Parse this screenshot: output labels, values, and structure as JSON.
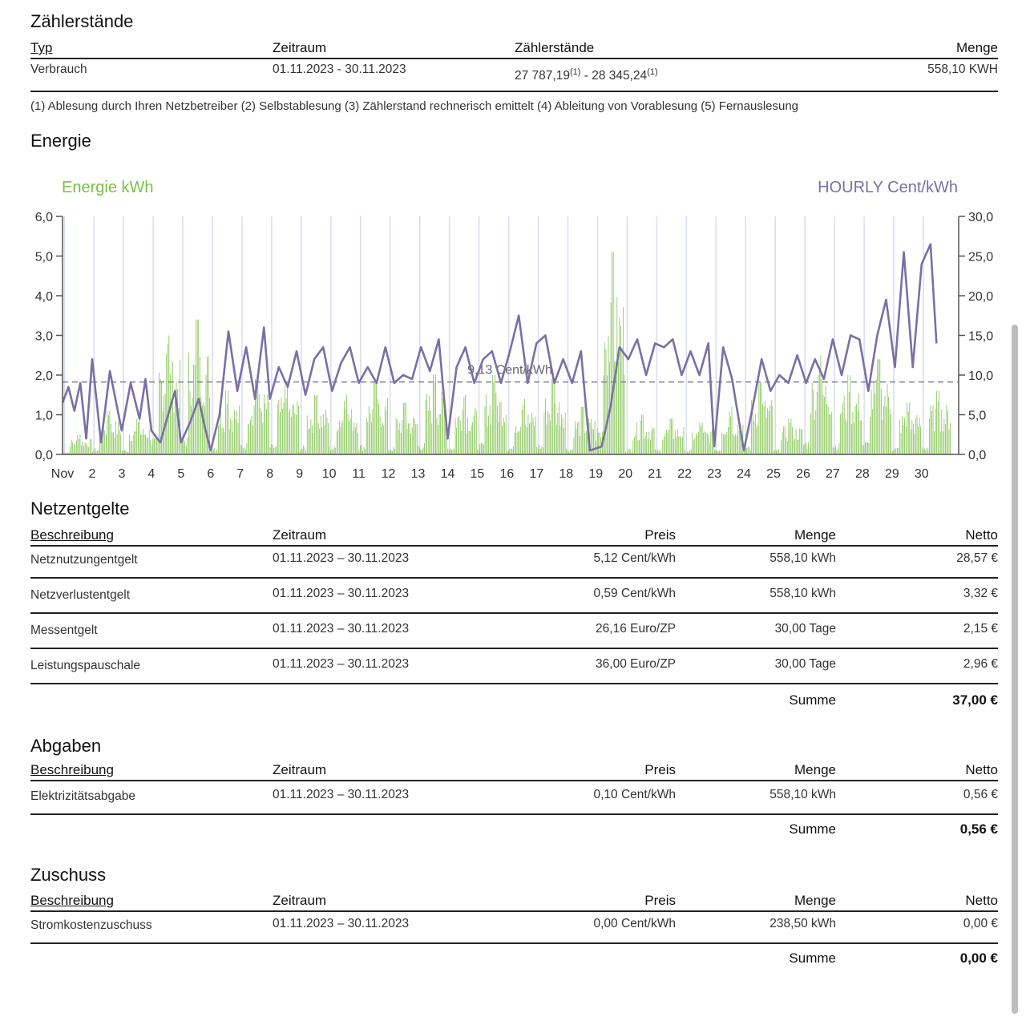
{
  "zaehlerstaende": {
    "title": "Zählerstände",
    "headers": [
      "Typ",
      "Zeitraum",
      "Zählerstände",
      "Menge"
    ],
    "row": {
      "typ": "Verbrauch",
      "zeitraum": "01.11.2023 - 30.11.2023",
      "stand_start": "27 787,19",
      "stand_start_note": "(1)",
      "separator": " - ",
      "stand_end": "28 345,24",
      "stand_end_note": "(1)",
      "menge": "558,10 KWH"
    },
    "footnote": "(1) Ablesung durch Ihren Netzbetreiber (2) Selbstablesung (3) Zählerstand rechnerisch emittelt (4) Ableitung von Vorablesung (5) Fernauslesung"
  },
  "energie": {
    "title": "Energie",
    "colors": {
      "energy": "#7ac143",
      "price": "#7b6fa6",
      "grid": "#d8dcf0",
      "axis": "#555555",
      "avg": "#7f7f99"
    }
  },
  "chart_data": {
    "type": "bar",
    "legend_left": "Energie kWh",
    "legend_right": "HOURLY Cent/kWh",
    "avg_label": "9,13 Cent/kWh",
    "avg_value": 9.13,
    "ylim_left": [
      0,
      6
    ],
    "ylim_right": [
      0,
      30
    ],
    "y_ticks_left": [
      "0,0",
      "1,0",
      "2,0",
      "3,0",
      "4,0",
      "5,0",
      "6,0"
    ],
    "y_ticks_right": [
      "0,0",
      "5,0",
      "10,0",
      "15,0",
      "20,0",
      "25,0",
      "30,0"
    ],
    "x_ticks": [
      "Nov",
      "2",
      "3",
      "4",
      "5",
      "6",
      "7",
      "8",
      "9",
      "10",
      "11",
      "12",
      "13",
      "14",
      "15",
      "16",
      "17",
      "18",
      "19",
      "20",
      "21",
      "22",
      "23",
      "24",
      "25",
      "26",
      "27",
      "28",
      "29",
      "30"
    ],
    "days": 30,
    "grid": true,
    "series": [
      {
        "name": "Energie kWh",
        "axis": "left",
        "daily_peak_kwh": [
          0.5,
          1.1,
          0.9,
          3.0,
          3.4,
          1.6,
          2.0,
          1.8,
          1.5,
          1.5,
          1.8,
          1.3,
          2.0,
          1.5,
          2.0,
          1.4,
          1.9,
          1.2,
          5.1,
          1.0,
          0.9,
          0.8,
          1.2,
          1.8,
          0.9,
          2.5,
          2.0,
          2.4,
          1.3,
          1.6
        ]
      },
      {
        "name": "HOURLY Cent/kWh",
        "axis": "right",
        "points": [
          [
            1.0,
            6.5
          ],
          [
            1.2,
            8.5
          ],
          [
            1.4,
            5.5
          ],
          [
            1.6,
            9.0
          ],
          [
            1.8,
            2.0
          ],
          [
            2.0,
            12.0
          ],
          [
            2.3,
            1.5
          ],
          [
            2.6,
            10.5
          ],
          [
            3.0,
            3.0
          ],
          [
            3.3,
            9.0
          ],
          [
            3.6,
            4.5
          ],
          [
            3.8,
            9.5
          ],
          [
            4.0,
            3.0
          ],
          [
            4.3,
            1.5
          ],
          [
            4.6,
            5.5
          ],
          [
            4.8,
            8.0
          ],
          [
            5.0,
            1.5
          ],
          [
            5.3,
            4.0
          ],
          [
            5.6,
            7.0
          ],
          [
            5.8,
            3.5
          ],
          [
            6.0,
            0.5
          ],
          [
            6.3,
            5.0
          ],
          [
            6.6,
            15.5
          ],
          [
            6.9,
            8.0
          ],
          [
            7.2,
            13.5
          ],
          [
            7.5,
            7.0
          ],
          [
            7.8,
            16.0
          ],
          [
            8.0,
            7.0
          ],
          [
            8.3,
            11.0
          ],
          [
            8.6,
            8.5
          ],
          [
            8.9,
            13.0
          ],
          [
            9.2,
            7.5
          ],
          [
            9.5,
            12.0
          ],
          [
            9.8,
            13.5
          ],
          [
            10.1,
            8.0
          ],
          [
            10.4,
            11.5
          ],
          [
            10.7,
            13.5
          ],
          [
            11.0,
            9.0
          ],
          [
            11.3,
            11.0
          ],
          [
            11.6,
            9.0
          ],
          [
            11.9,
            13.5
          ],
          [
            12.2,
            9.0
          ],
          [
            12.5,
            10.0
          ],
          [
            12.8,
            9.5
          ],
          [
            13.1,
            13.5
          ],
          [
            13.4,
            10.5
          ],
          [
            13.7,
            14.5
          ],
          [
            14.0,
            2.0
          ],
          [
            14.3,
            11.0
          ],
          [
            14.6,
            13.5
          ],
          [
            14.9,
            9.0
          ],
          [
            15.2,
            12.0
          ],
          [
            15.5,
            13.0
          ],
          [
            15.8,
            9.0
          ],
          [
            16.1,
            13.0
          ],
          [
            16.4,
            17.5
          ],
          [
            16.7,
            9.0
          ],
          [
            17.0,
            14.0
          ],
          [
            17.3,
            15.0
          ],
          [
            17.6,
            9.0
          ],
          [
            17.9,
            12.0
          ],
          [
            18.2,
            9.0
          ],
          [
            18.5,
            13.0
          ],
          [
            18.8,
            0.5
          ],
          [
            19.2,
            1.0
          ],
          [
            19.5,
            6.0
          ],
          [
            19.8,
            13.5
          ],
          [
            20.1,
            12.0
          ],
          [
            20.4,
            14.5
          ],
          [
            20.7,
            10.0
          ],
          [
            21.0,
            14.0
          ],
          [
            21.3,
            13.5
          ],
          [
            21.6,
            14.5
          ],
          [
            21.9,
            10.0
          ],
          [
            22.2,
            13.0
          ],
          [
            22.5,
            10.0
          ],
          [
            22.8,
            14.0
          ],
          [
            23.0,
            1.0
          ],
          [
            23.3,
            13.5
          ],
          [
            23.6,
            9.5
          ],
          [
            24.0,
            0.5
          ],
          [
            24.3,
            6.0
          ],
          [
            24.6,
            12.0
          ],
          [
            24.9,
            8.0
          ],
          [
            25.2,
            10.0
          ],
          [
            25.5,
            9.0
          ],
          [
            25.8,
            12.5
          ],
          [
            26.1,
            9.0
          ],
          [
            26.4,
            12.0
          ],
          [
            26.7,
            9.5
          ],
          [
            27.0,
            14.5
          ],
          [
            27.3,
            10.0
          ],
          [
            27.6,
            15.0
          ],
          [
            27.9,
            14.5
          ],
          [
            28.2,
            8.0
          ],
          [
            28.5,
            15.0
          ],
          [
            28.8,
            19.5
          ],
          [
            29.1,
            11.0
          ],
          [
            29.4,
            25.5
          ],
          [
            29.7,
            11.0
          ],
          [
            30.0,
            24.0
          ],
          [
            30.3,
            26.5
          ],
          [
            30.5,
            14.0
          ]
        ]
      }
    ]
  },
  "netzentgelte": {
    "title": "Netzentgelte",
    "headers": [
      "Beschreibung",
      "Zeitraum",
      "Preis",
      "Menge",
      "Netto"
    ],
    "rows": [
      [
        "Netznutzungentgelt",
        "01.11.2023 – 30.11.2023",
        "5,12 Cent/kWh",
        "558,10 kWh",
        "28,57 €"
      ],
      [
        "Netzverlustentgelt",
        "01.11.2023 – 30.11.2023",
        "0,59 Cent/kWh",
        "558,10 kWh",
        "3,32 €"
      ],
      [
        "Messentgelt",
        "01.11.2023 – 30.11.2023",
        "26,16 Euro/ZP",
        "30,00 Tage",
        "2,15 €"
      ],
      [
        "Leistungspauschale",
        "01.11.2023 – 30.11.2023",
        "36,00 Euro/ZP",
        "30,00 Tage",
        "2,96 €"
      ]
    ],
    "sum_label": "Summe",
    "sum_value": "37,00 €"
  },
  "abgaben": {
    "title": "Abgaben",
    "headers": [
      "Beschreibung",
      "Zeitraum",
      "Preis",
      "Menge",
      "Netto"
    ],
    "rows": [
      [
        "Elektrizitätsabgabe",
        "01.11.2023 – 30.11.2023",
        "0,10 Cent/kWh",
        "558,10 kWh",
        "0,56 €"
      ]
    ],
    "sum_label": "Summe",
    "sum_value": "0,56 €"
  },
  "zuschuss": {
    "title": "Zuschuss",
    "headers": [
      "Beschreibung",
      "Zeitraum",
      "Preis",
      "Menge",
      "Netto"
    ],
    "rows": [
      [
        "Stromkostenzuschuss",
        "01.11.2023 – 30.11.2023",
        "0,00 Cent/kWh",
        "238,50 kWh",
        "0,00 €"
      ]
    ],
    "sum_label": "Summe",
    "sum_value": "0,00 €"
  }
}
